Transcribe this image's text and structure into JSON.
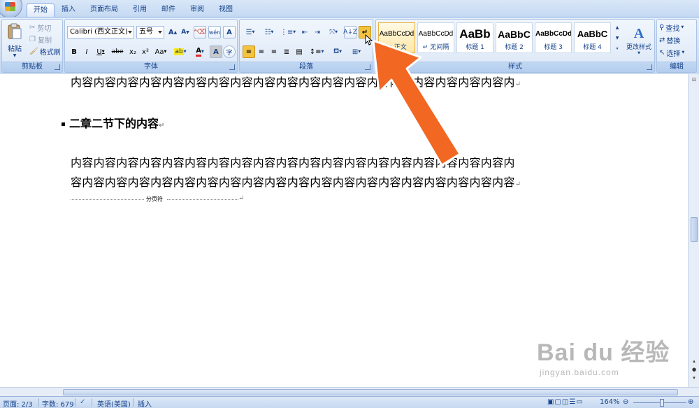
{
  "tabs": [
    "开始",
    "插入",
    "页面布局",
    "引用",
    "邮件",
    "审阅",
    "视图"
  ],
  "clipboard": {
    "paste": "粘贴",
    "cut": "剪切",
    "copy": "复制",
    "format_painter": "格式刷",
    "group_label": "剪贴板"
  },
  "font": {
    "font_name": "Calibri (西文正文)",
    "font_size": "五号",
    "group_label": "字体",
    "grow": "A",
    "shrink": "A",
    "bold": "B",
    "italic": "I",
    "underline": "U",
    "strike": "abe",
    "subscript": "x₂",
    "superscript": "x²",
    "change_case": "Aa",
    "phonetic": "wén",
    "border": "A",
    "shade": "A",
    "circle": "字"
  },
  "paragraph": {
    "group_label": "段落"
  },
  "styles": {
    "group_label": "样式",
    "items": [
      {
        "preview": "AaBbCcDd",
        "name": "↵ 正文"
      },
      {
        "preview": "AaBbCcDd",
        "name": "↵ 无间隔"
      },
      {
        "preview": "AaBb",
        "name": "标题 1"
      },
      {
        "preview": "AaBbC",
        "name": "标题 2"
      },
      {
        "preview": "AaBbCcDd",
        "name": "标题 3"
      },
      {
        "preview": "AaBbC",
        "name": "标题 4"
      }
    ],
    "change_styles": "更改样式"
  },
  "editing": {
    "find": "查找",
    "replace": "替换",
    "select": "选择",
    "group_label": "编辑"
  },
  "document": {
    "line_top": "内容内容内容内容内容内容内容内容内容内容内容内容内容内容内容内容内容内容内容内",
    "heading": "二章二节下的内容",
    "body_line1": "内容内容内容内容内容内容内容内容内容内容内容内容内容内容内容内容内容内容内容内",
    "body_line2": "容内容内容内容内容内容内容内容内容内容内容内容内容内容内容内容内容内容内容内容",
    "page_break": "分页符"
  },
  "status": {
    "page": "页面: 2/3",
    "words": "字数: 679",
    "language": "英语(美国)",
    "mode": "插入",
    "zoom": "164%"
  },
  "watermark": {
    "brand": "Bai du 经验",
    "url": "jingyan.baidu.com"
  },
  "colors": {
    "accent": "#15428b",
    "highlight": "#f5c342",
    "arrow": "#f26722"
  }
}
